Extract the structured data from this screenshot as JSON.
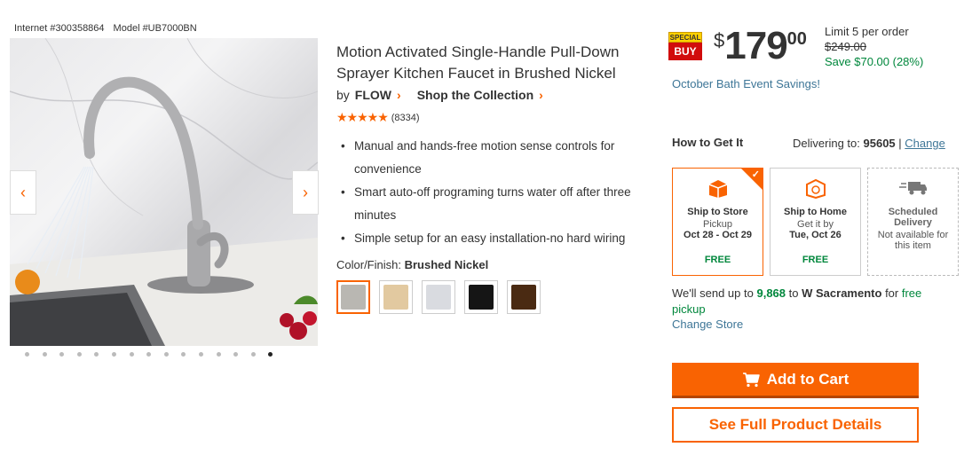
{
  "ids": {
    "internet": "Internet #300358864",
    "model": "Model #UB7000BN"
  },
  "gallery": {
    "prev_icon": "chevron-left-icon",
    "next_icon": "chevron-right-icon",
    "dot_count": 15,
    "active_dot": 14
  },
  "product": {
    "title": "Motion Activated Single-Handle Pull-Down Sprayer Kitchen Faucet in Brushed Nickel",
    "by": "by",
    "brand": "FLOW",
    "collection": "Shop the Collection",
    "rating_stars": 4.5,
    "review_count": "(8334)",
    "bullets": [
      "Manual and hands-free motion sense controls for convenience",
      "Smart auto-off programing turns water off after three minutes",
      "Simple setup for an easy installation-no hard wiring"
    ],
    "finish_label": "Color/Finish:",
    "finish_value": "Brushed Nickel",
    "swatches": [
      {
        "name": "Brushed Nickel",
        "color": "#b9b7b2",
        "selected": true
      },
      {
        "name": "Gold",
        "color": "#e2c9a0",
        "selected": false
      },
      {
        "name": "Chrome",
        "color": "#d9dbe0",
        "selected": false
      },
      {
        "name": "Black",
        "color": "#151515",
        "selected": false
      },
      {
        "name": "Bronze",
        "color": "#4a2a12",
        "selected": false
      }
    ]
  },
  "pricing": {
    "badge_top": "SPECIAL",
    "badge_bottom": "BUY",
    "currency": "$",
    "dollars": "179",
    "cents": "00",
    "limit": "Limit 5 per order",
    "was": "$249.00",
    "save": "Save $70.00 (28%)",
    "promo": "October Bath Event Savings!"
  },
  "fulfillment": {
    "how_to": "How to Get It",
    "delivering_to": "Delivering to:",
    "zip": "95605",
    "change": "Change",
    "options": [
      {
        "name": "Ship to Store",
        "sub": "Pickup",
        "date": "Oct 28 - Oct 29",
        "price": "FREE"
      },
      {
        "name": "Ship to Home",
        "sub": "Get it by",
        "date": "Tue, Oct 26",
        "price": "FREE"
      },
      {
        "name": "Scheduled Delivery",
        "sub": "Not available for this item"
      }
    ],
    "note_prefix": "We'll send up to",
    "note_count": "9,868",
    "note_mid": "to",
    "note_store": "W Sacramento",
    "note_for": "for",
    "note_free": "free pickup",
    "change_store": "Change Store"
  },
  "actions": {
    "add_to_cart": "Add to Cart",
    "full_details": "See Full Product Details"
  },
  "colors": {
    "accent": "#f96302",
    "link": "#3e7697",
    "success": "#00873c"
  }
}
